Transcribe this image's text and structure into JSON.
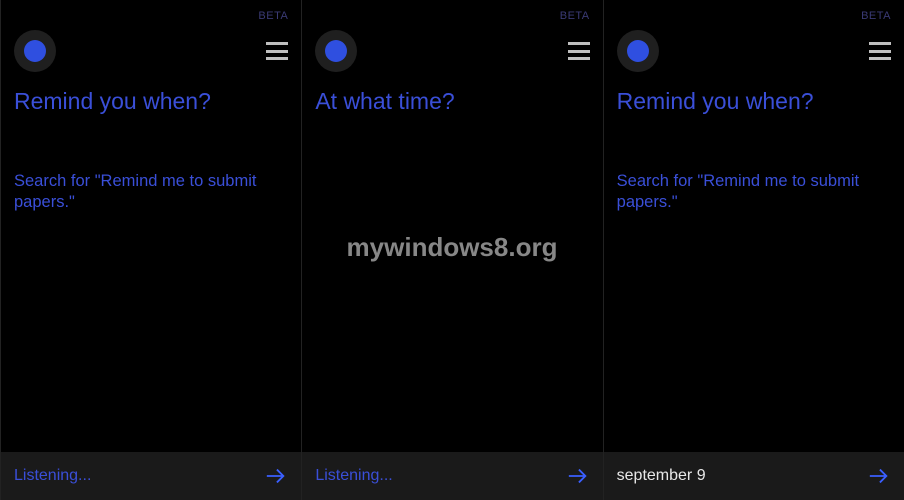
{
  "watermark": "mywindows8.org",
  "panels": [
    {
      "beta": "BETA",
      "prompt": "Remind you when?",
      "subtext": "Search for \"Remind me to submit papers.\"",
      "input": {
        "text": "Listening...",
        "mode": "listening"
      }
    },
    {
      "beta": "BETA",
      "prompt": "At what time?",
      "subtext": "",
      "input": {
        "text": "Listening...",
        "mode": "listening"
      }
    },
    {
      "beta": "BETA",
      "prompt": "Remind you when?",
      "subtext": "Search for \"Remind me to submit papers.\"",
      "input": {
        "text": "september 9",
        "mode": "typed"
      }
    }
  ]
}
